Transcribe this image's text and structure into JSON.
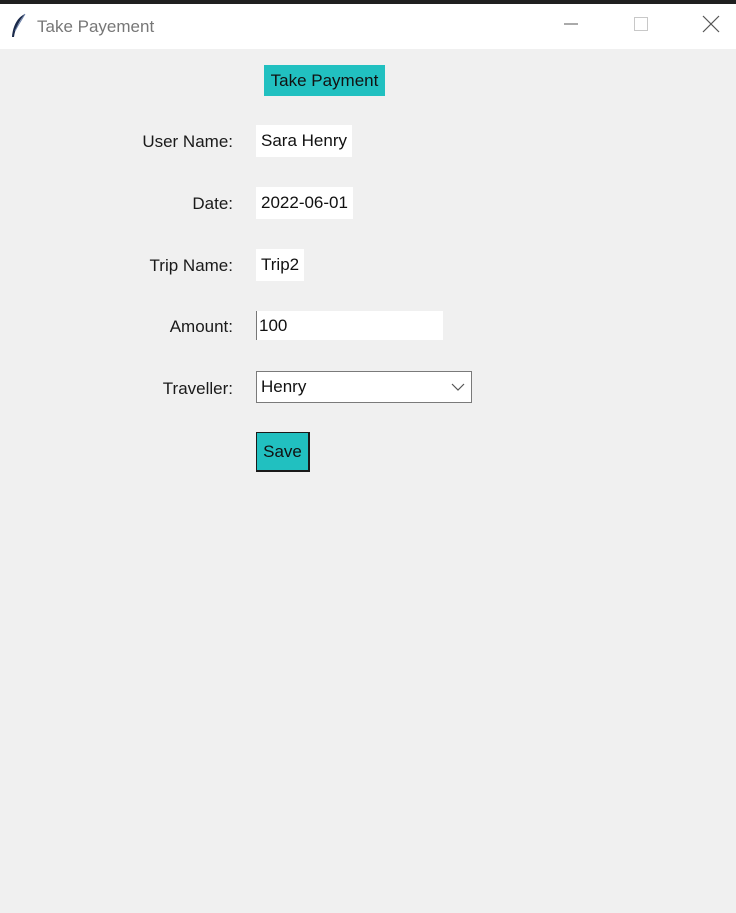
{
  "window": {
    "title": "Take Payement"
  },
  "header": {
    "button_label": "Take Payment"
  },
  "form": {
    "user_name_label": "User Name:",
    "user_name_value": "Sara Henry",
    "date_label": "Date:",
    "date_value": "2022-06-01",
    "trip_name_label": "Trip Name:",
    "trip_name_value": "Trip2",
    "amount_label": "Amount:",
    "amount_value": "100",
    "traveller_label": "Traveller:",
    "traveller_value": "Henry",
    "save_label": "Save"
  },
  "colors": {
    "accent": "#21c0c0",
    "background": "#f0f0f0"
  },
  "icons": {
    "app": "feather-icon",
    "minimize": "minimize-icon",
    "maximize": "maximize-icon",
    "close": "close-icon",
    "dropdown": "chevron-down-icon"
  }
}
